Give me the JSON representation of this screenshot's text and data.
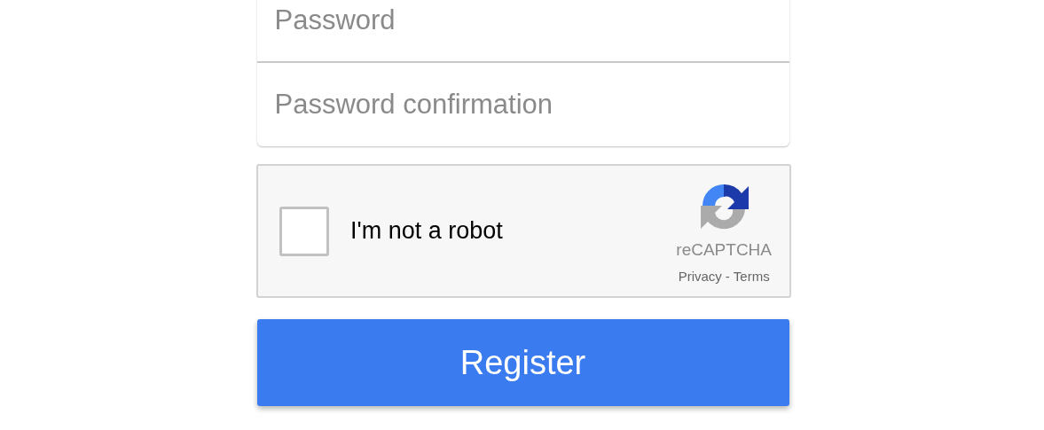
{
  "fields": [
    {
      "placeholder": "Password"
    },
    {
      "placeholder": "Password confirmation"
    }
  ],
  "captcha": {
    "label": "I'm not a robot",
    "checked": false,
    "brand": "reCAPTCHA",
    "links": [
      {
        "label": "Privacy"
      },
      {
        "label": "Terms"
      }
    ],
    "separator": "-"
  },
  "submit": {
    "label": "Register"
  }
}
